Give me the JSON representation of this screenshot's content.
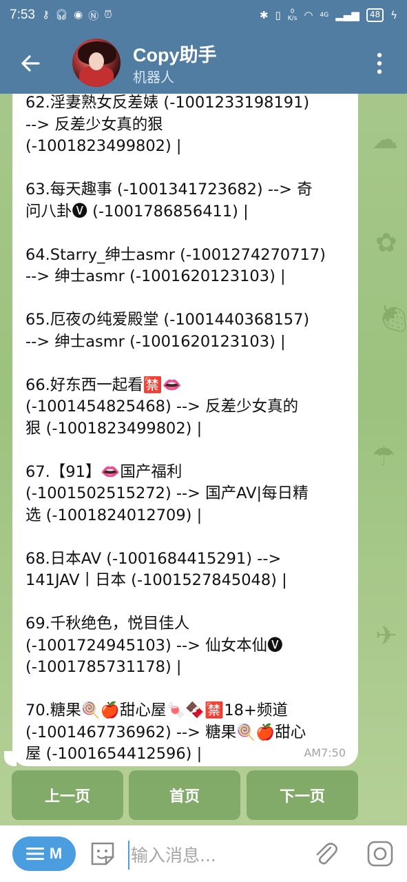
{
  "status_bar": {
    "time": "7:53",
    "speed_value": "0",
    "speed_unit": "K/s",
    "network": "4G",
    "battery": "48"
  },
  "header": {
    "title": "Copy助手",
    "subtitle": "机器人"
  },
  "message": {
    "text": "62.淫妻熟女反差婊 (-1001233198191)\n--> 反差少女真的狠\n(-1001823499802) |\n\n63.每天趣事 (-1001341723682) --> 奇\n问八卦🅥 (-1001786856411) |\n\n64.Starry_绅士asmr (-1001274270717)\n--> 绅士asmr (-1001620123103) |\n\n65.厄夜の纯爱殿堂 (-1001440368157)\n--> 绅士asmr (-1001620123103) |\n\n66.好东西一起看🈲👄\n(-1001454825468) --> 反差少女真的\n狠 (-1001823499802) |\n\n67.【91】👄国产福利\n(-1001502515272) --> 国产AV|每日精\n选 (-1001824012709) |\n\n68.日本AV (-1001684415291) -->\n141JAV丨日本 (-1001527845048) |\n\n69.千秋绝色，悦目佳人\n(-1001724945103) --> 仙女本仙🅥\n(-1001785731178) |\n\n70.糖果🍭🍎甜心屋🍬🍫🈲18+频道\n(-1001467736962) --> 糖果🍭🍎甜心\n屋 (-1001654412596) |",
    "time": "AM7:50"
  },
  "keyboard": {
    "prev": "上一页",
    "home": "首页",
    "next": "下一页"
  },
  "input_bar": {
    "menu_label": "M",
    "placeholder": "输入消息..."
  }
}
